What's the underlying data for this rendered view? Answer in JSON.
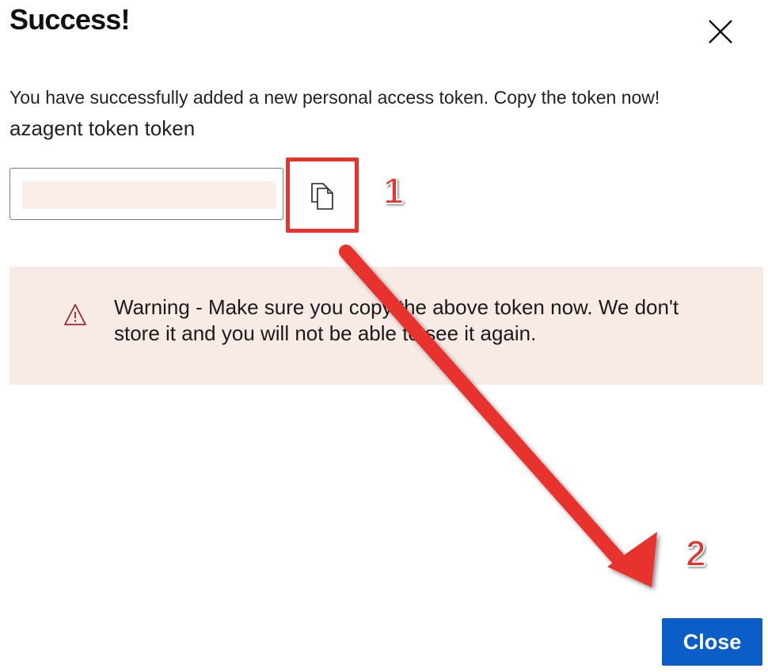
{
  "dialog": {
    "title": "Success!",
    "message": "You have successfully added a new personal access token. Copy the token now!",
    "token_name": "azagent token token",
    "token_value": "",
    "warning_text": "Warning - Make sure you copy the above token now. We don't store it and you will not be able to see it again.",
    "close_button_label": "Close"
  },
  "annotations": {
    "step_1": "1",
    "step_2": "2"
  },
  "icons": {
    "close": "close-icon",
    "copy": "copy-icon",
    "warning": "warning-icon"
  },
  "colors": {
    "accent": "#0b5ec8",
    "warning_background": "#f8ebe5",
    "annotation": "#e8322d"
  }
}
